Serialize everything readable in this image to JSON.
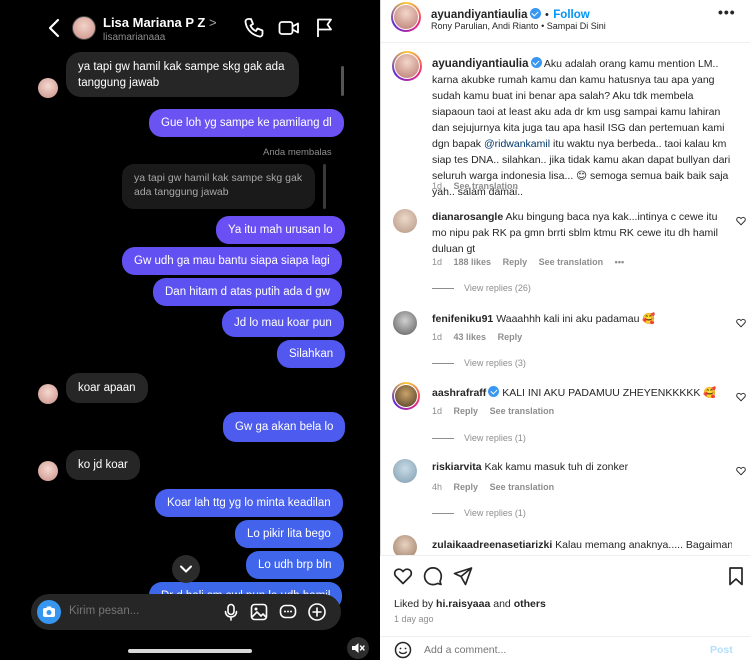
{
  "dm": {
    "contact_name": "Lisa Mariana P Z",
    "contact_chevron": ">",
    "contact_username": "lisamarianaaa",
    "reply_label": "Anda membalas",
    "reply_quote": "ya tapi gw hamil kak sampe skg gak ada tanggung jawab",
    "messages": [
      {
        "dir": "in",
        "lines": [
          "ya tapi gw hamil kak sampe skg gak ada",
          "tanggung jawab"
        ]
      },
      {
        "dir": "out",
        "text": "Gue loh yg sampe ke pamilang dl"
      },
      {
        "dir": "out",
        "text": "Ya itu mah urusan lo"
      },
      {
        "dir": "out",
        "text": "Gw udh ga mau bantu siapa siapa lagi"
      },
      {
        "dir": "out",
        "text": "Dan hitam d atas putih ada d gw"
      },
      {
        "dir": "out",
        "text": "Jd lo mau koar pun"
      },
      {
        "dir": "out",
        "text": "Silahkan"
      },
      {
        "dir": "in",
        "text": "koar apaan"
      },
      {
        "dir": "out",
        "text": "Gw ga akan bela lo"
      },
      {
        "dir": "in",
        "text": "ko jd koar"
      },
      {
        "dir": "out",
        "text": "Koar lah ttg yg lo minta keadilan"
      },
      {
        "dir": "out",
        "text": "Lo pikir lita bego"
      },
      {
        "dir": "out",
        "text": "Lo udh brp bln"
      },
      {
        "dir": "out",
        "text": "Dr d bali sm owl pun lo udh hamil"
      }
    ],
    "composer_placeholder": "Kirim pesan..."
  },
  "ig": {
    "author": "ayuandiyantiaulia",
    "follow_label": "Follow",
    "separator": "•",
    "subtitle": "Rony Parulian, Andi Rianto • Sampai Di Sini",
    "more": "•••",
    "caption_author": "ayuandiyantiaulia",
    "caption_part1": "Aku adalah orang kamu mention LM.. karna akubke rumah kamu dan kamu hatusnya tau apa yang sudah kamu buat ini benar apa salah? Aku tdk membela siapaoun taoi at least aku ada dr km usg sampai kamu lahiran dan sejujurnya kita juga tau apa hasil ISG dan pertemuan kami dgn bapak",
    "caption_mention": "@ridwankamil",
    "caption_part2": "itu waktu nya berbeda.. taoi kalau km siap tes DNA.. silahkan.. jika tidak kamu akan dapat bullyan dari seluruh warga indonesia lisa...",
    "caption_part3": "semoga semua baik baik saja yah.. salam damai..",
    "caption_time": "1d",
    "see_translation": "See translation",
    "reply_label": "Reply",
    "comments": [
      {
        "user": "dianarosangle",
        "text": "Aku bingung baca nya kak...intinya c cewe itu mo nipu pak RK pa gmn brrti sblm ktmu RK cewe itu dh hamil duluan gt",
        "time": "1d",
        "likes": "188 likes",
        "replies": "View replies (26)",
        "has_translation": true
      },
      {
        "user": "fenifeniku91",
        "text": "Waaahhh kali ini aku padamau",
        "time": "1d",
        "likes": "43 likes",
        "replies": "View replies (3)"
      },
      {
        "user": "aashrafraff",
        "text": "KALI INI AKU PADAMUU ZHEYENKKKKK",
        "time": "1d",
        "replies": "View replies (1)"
      },
      {
        "user": "riskiarvita",
        "text": "Kak kamu masuk tuh di zonker",
        "time": "4h",
        "replies": "View replies (1)"
      },
      {
        "user": "zulaikaadreenasetiarizki",
        "text": "Kalau memang anaknya..... Bagaimana",
        "time": "",
        "replies": ""
      }
    ],
    "liked_prefix": "Liked by",
    "liked_user": "hi.raisyaaa",
    "liked_and": "and",
    "liked_others": "others",
    "posted_ago": "1 day ago",
    "add_comment_placeholder": "Add a comment...",
    "post_label": "Post"
  },
  "colors": {
    "out_bubble_top": "#7c4dff",
    "out_bubble_bottom": "#3d5afe",
    "in_bubble": "#262626",
    "link_blue": "#0095f6"
  },
  "icons": [
    "back-icon",
    "phone-icon",
    "video-icon",
    "flag-icon",
    "camera-icon",
    "microphone-icon",
    "gallery-icon",
    "sticker-icon",
    "plus-icon",
    "chevron-down-icon",
    "mute-icon",
    "heart-icon",
    "comment-icon",
    "share-icon",
    "bookmark-icon",
    "emoji-icon",
    "verified-icon"
  ]
}
